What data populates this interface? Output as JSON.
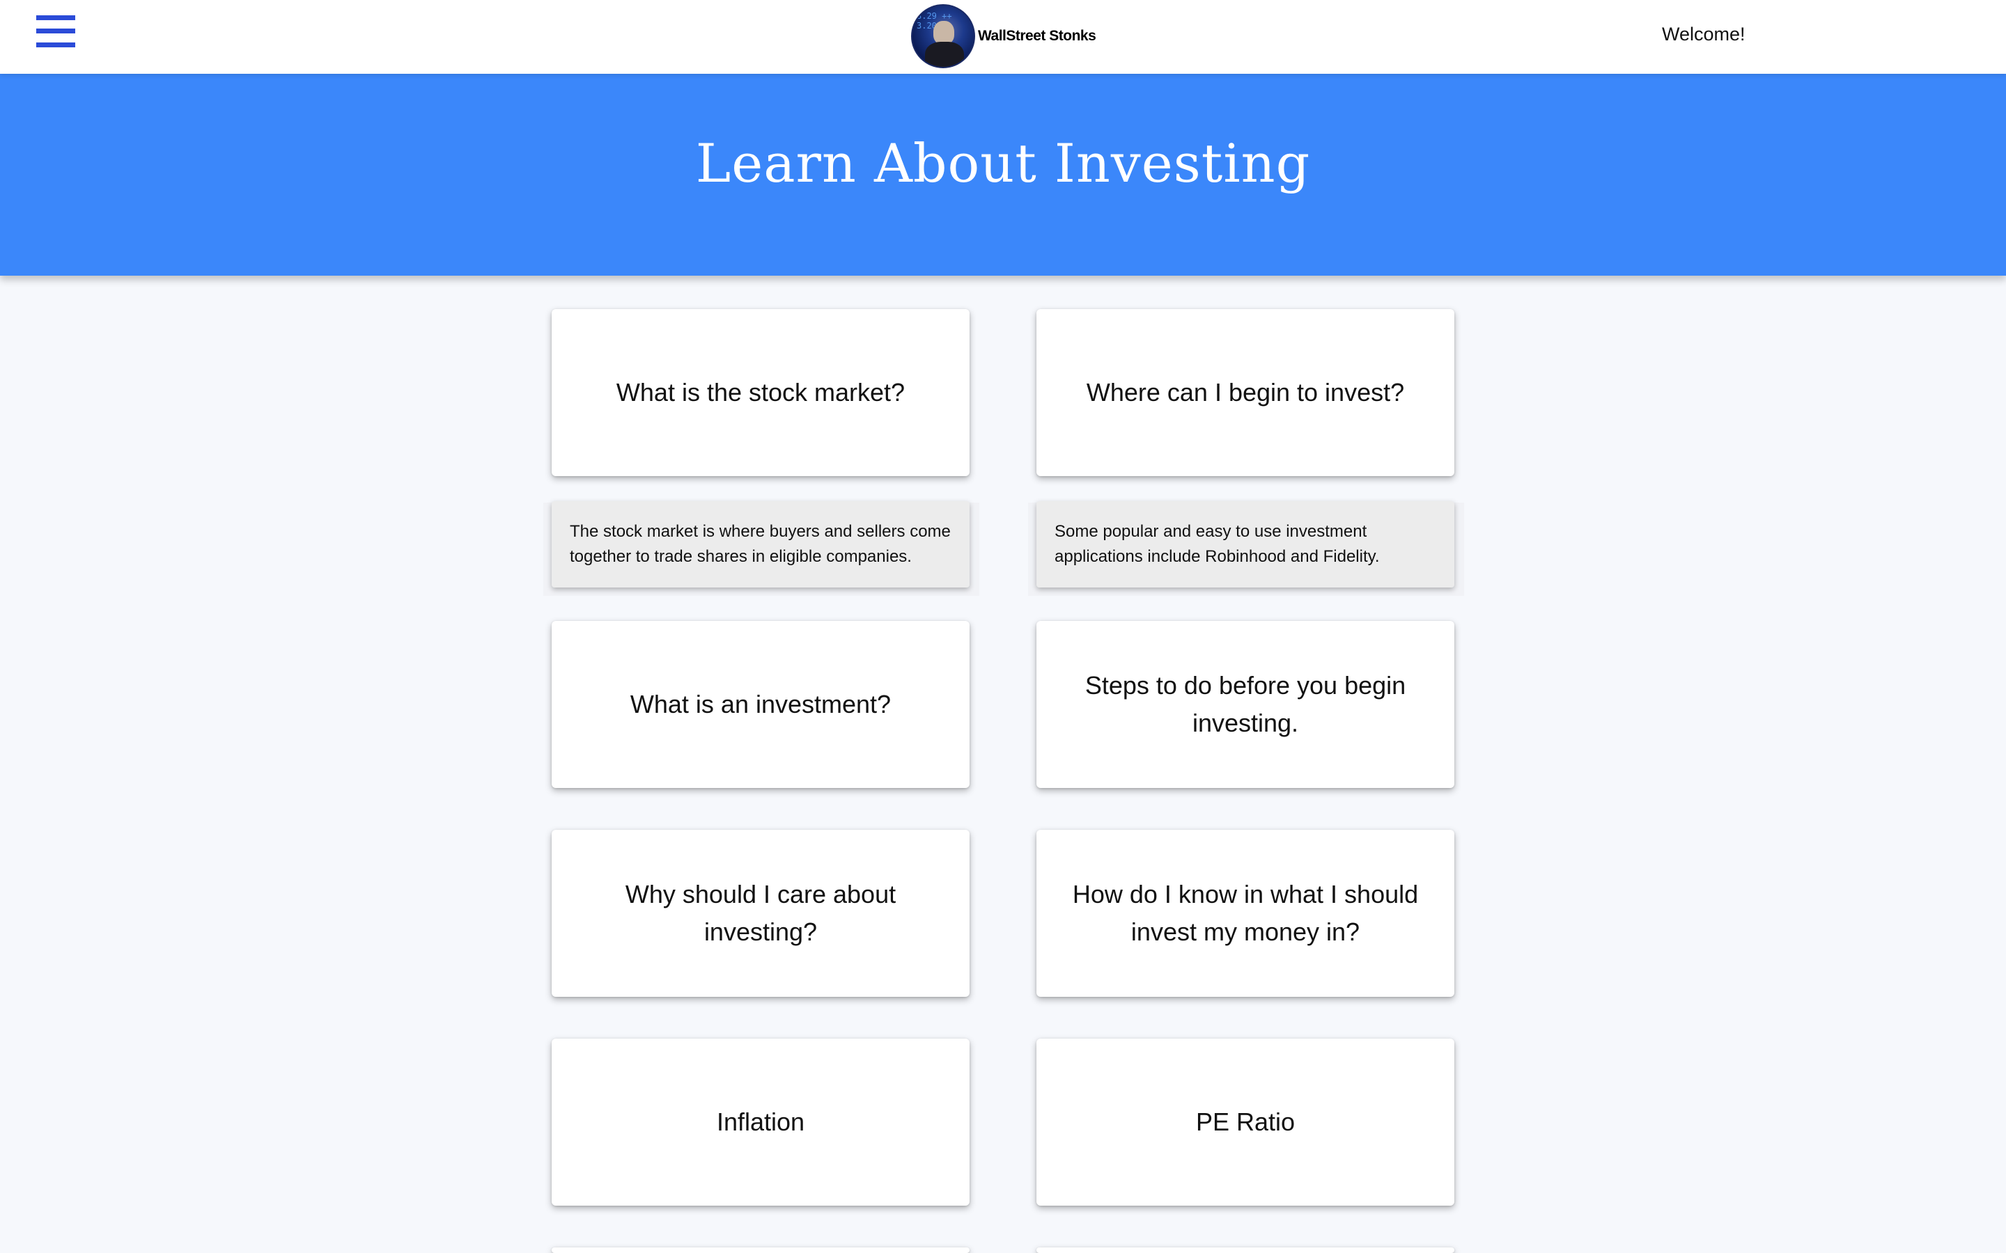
{
  "header": {
    "brand_name": "WallStreet Stonks",
    "welcome": "Welcome!",
    "logo_ticker": "3.29 ++ 3.20"
  },
  "hero": {
    "title": "Learn About Investing"
  },
  "cards": [
    {
      "question": "What is the stock market?",
      "answer": "The stock market is where buyers and sellers come together to trade shares in eligible companies.",
      "expanded": true
    },
    {
      "question": "Where can I begin to invest?",
      "answer": "Some popular and easy to use investment applications include Robinhood and Fidelity.",
      "expanded": true
    },
    {
      "question": "What is an investment?",
      "expanded": false
    },
    {
      "question": "Steps to do before you begin investing.",
      "expanded": false
    },
    {
      "question": "Why should I care about investing?",
      "expanded": false
    },
    {
      "question": "How do I know in what I should invest my money in?",
      "expanded": false
    },
    {
      "question": "Inflation",
      "expanded": false
    },
    {
      "question": "PE Ratio",
      "expanded": false
    }
  ],
  "colors": {
    "accent": "#3b87fa",
    "menu_icon": "#2b4bd8",
    "background": "#f6f8fc",
    "answer_bg": "#ececec"
  },
  "icons": {
    "menu": "hamburger-menu-icon",
    "logo": "brand-logo-icon"
  }
}
